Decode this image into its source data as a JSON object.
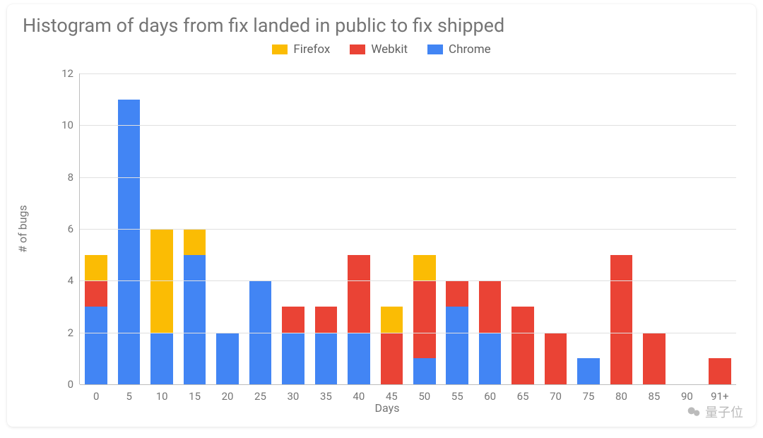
{
  "title": "Histogram of days from fix landed in public to fix shipped",
  "xlabel": "Days",
  "ylabel": "# of bugs",
  "legend": [
    {
      "name": "Firefox",
      "color": "#fbbc04"
    },
    {
      "name": "Webkit",
      "color": "#ea4335"
    },
    {
      "name": "Chrome",
      "color": "#4285f4"
    }
  ],
  "watermark": {
    "label": "量子位"
  },
  "chart_data": {
    "type": "bar",
    "stacked": true,
    "xlabel": "Days",
    "ylabel": "# of bugs",
    "ylim": [
      0,
      12
    ],
    "yticks": [
      0,
      2,
      4,
      6,
      8,
      10,
      12
    ],
    "categories": [
      "0",
      "5",
      "10",
      "15",
      "20",
      "25",
      "30",
      "35",
      "40",
      "45",
      "50",
      "55",
      "60",
      "65",
      "70",
      "75",
      "80",
      "85",
      "90",
      "91+"
    ],
    "series": [
      {
        "name": "Chrome",
        "color": "#4285f4",
        "values": [
          3,
          11,
          2,
          5,
          2,
          4,
          2,
          2,
          2,
          0,
          1,
          3,
          2,
          0,
          0,
          1,
          0,
          0,
          0,
          0
        ]
      },
      {
        "name": "Webkit",
        "color": "#ea4335",
        "values": [
          1,
          0,
          0,
          0,
          0,
          0,
          1,
          1,
          3,
          2,
          3,
          1,
          2,
          3,
          2,
          0,
          5,
          2,
          0,
          1
        ]
      },
      {
        "name": "Firefox",
        "color": "#fbbc04",
        "values": [
          1,
          0,
          4,
          1,
          0,
          0,
          0,
          0,
          0,
          1,
          1,
          0,
          0,
          0,
          0,
          0,
          0,
          0,
          0,
          0
        ]
      }
    ],
    "title": "Histogram of days from fix landed in public to fix shipped"
  }
}
